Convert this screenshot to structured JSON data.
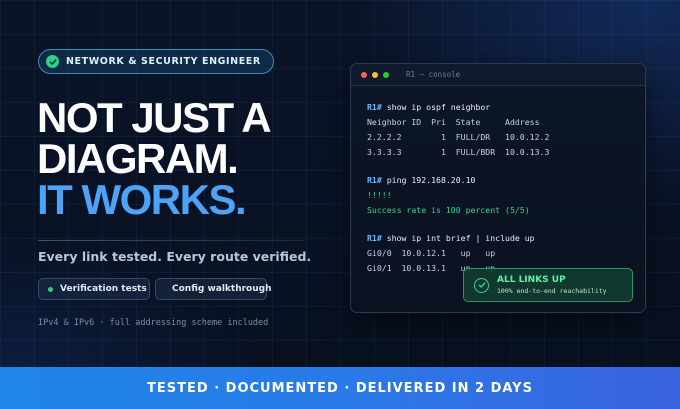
{
  "badge": {
    "icon": "check-icon",
    "label": "NETWORK & SECURITY ENGINEER"
  },
  "headline": {
    "line1": "NOT JUST A",
    "line2": "DIAGRAM.",
    "line3": "IT WORKS."
  },
  "subline": "Every link tested. Every route verified.",
  "chips": [
    {
      "label": "Verification tests",
      "dot_color": "#2fd08a"
    },
    {
      "label": "Config walkthrough",
      "dot_color": "#3aa0ff"
    }
  ],
  "note": "IPv4 & IPv6 · full addressing scheme included",
  "console": {
    "title": "R1 — console",
    "prompt": "R1#",
    "cmd1": " show ip ospf neighbor",
    "ospf_header": "Neighbor ID  Pri  State     Address",
    "ospf_row1": "2.2.2.2        1  FULL/DR   10.0.12.2",
    "ospf_row2": "3.3.3.3        1  FULL/BDR  10.0.13.3",
    "cmd2": " ping 192.168.20.10",
    "ping_marks": "!!!!!",
    "ping_result": "Success rate is 100 percent (5/5)",
    "cmd3": " show ip int brief | include up",
    "int_row1": "Gi0/0  10.0.12.1   up   up",
    "int_row2": "Gi0/1  10.0.13.1   up   up"
  },
  "status": {
    "icon": "check-icon",
    "title": "ALL LINKS UP",
    "subtitle": "100% end-to-end reachability"
  },
  "footer": "TESTED · DOCUMENTED · DELIVERED IN 2 DAYS",
  "colors": {
    "accent_blue": "#4da3f5",
    "success_green": "#38d48d",
    "background": "#0a1428",
    "footer_gradient_start": "#1e86e6",
    "footer_gradient_end": "#3a62df"
  }
}
